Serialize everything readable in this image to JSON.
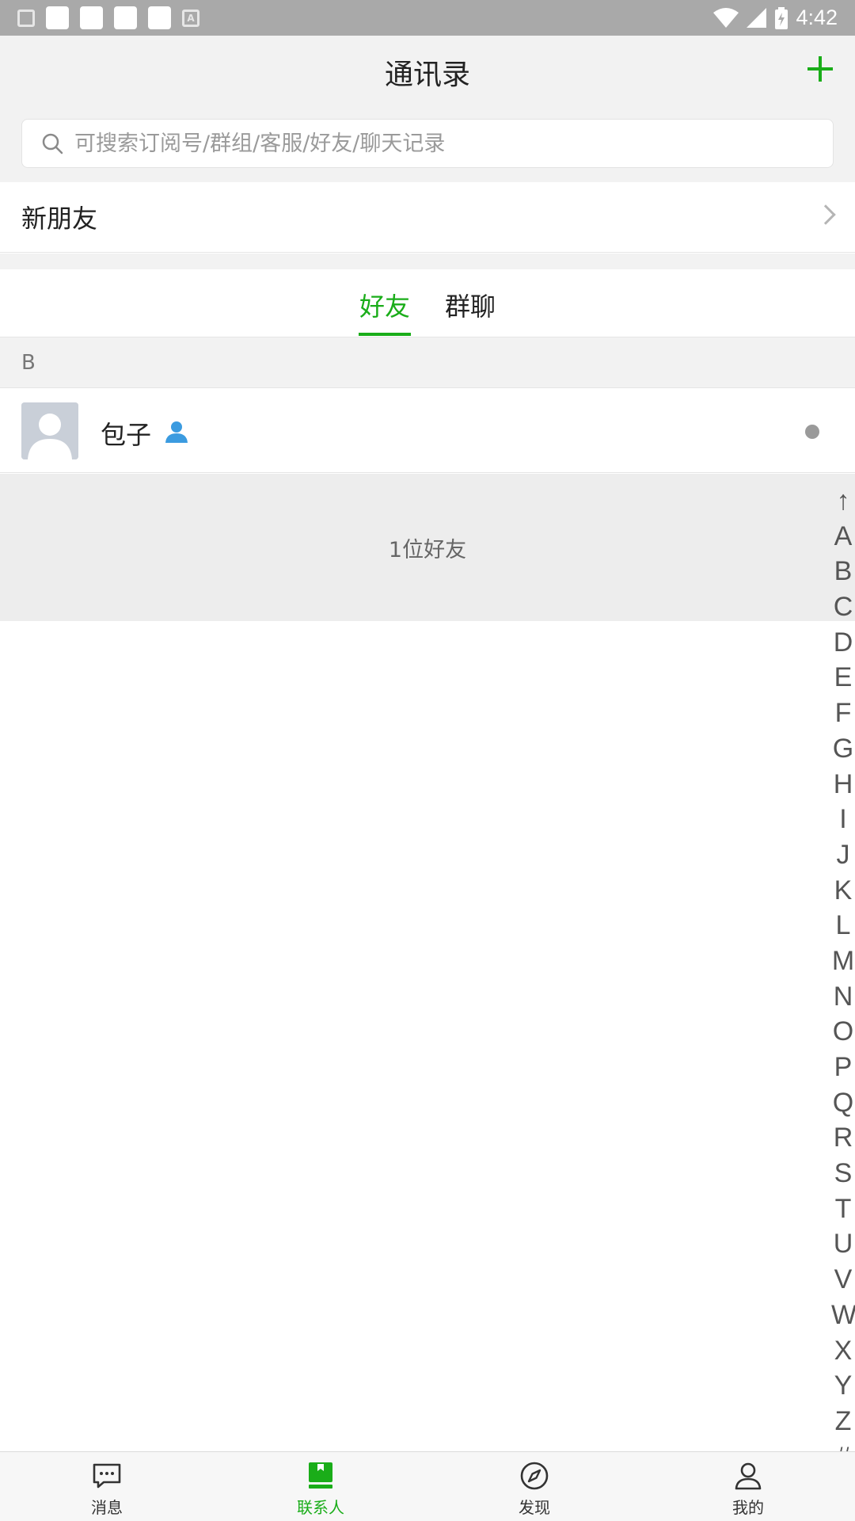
{
  "status_bar": {
    "time": "4:42"
  },
  "header": {
    "title": "通讯录",
    "add_icon": "plus-icon"
  },
  "search": {
    "placeholder": "可搜索订阅号/群组/客服/好友/聊天记录"
  },
  "new_friends": {
    "label": "新朋友"
  },
  "tabs": [
    {
      "label": "好友",
      "active": true
    },
    {
      "label": "群聊",
      "active": false
    }
  ],
  "contacts": {
    "sections": [
      {
        "letter": "B",
        "items": [
          {
            "name": "包子"
          }
        ]
      }
    ],
    "count_text": "1位好友"
  },
  "index_bar": [
    "↑",
    "A",
    "B",
    "C",
    "D",
    "E",
    "F",
    "G",
    "H",
    "I",
    "J",
    "K",
    "L",
    "M",
    "N",
    "O",
    "P",
    "Q",
    "R",
    "S",
    "T",
    "U",
    "V",
    "W",
    "X",
    "Y",
    "Z",
    "#"
  ],
  "bottom_nav": [
    {
      "label": "消息",
      "icon": "chat-icon",
      "active": false
    },
    {
      "label": "联系人",
      "icon": "contacts-book-icon",
      "active": true
    },
    {
      "label": "发现",
      "icon": "compass-icon",
      "active": false
    },
    {
      "label": "我的",
      "icon": "person-icon",
      "active": false
    }
  ],
  "colors": {
    "accent": "#1aad19",
    "status_bar": "#a9a9a9",
    "header_bg": "#f2f2f2"
  }
}
